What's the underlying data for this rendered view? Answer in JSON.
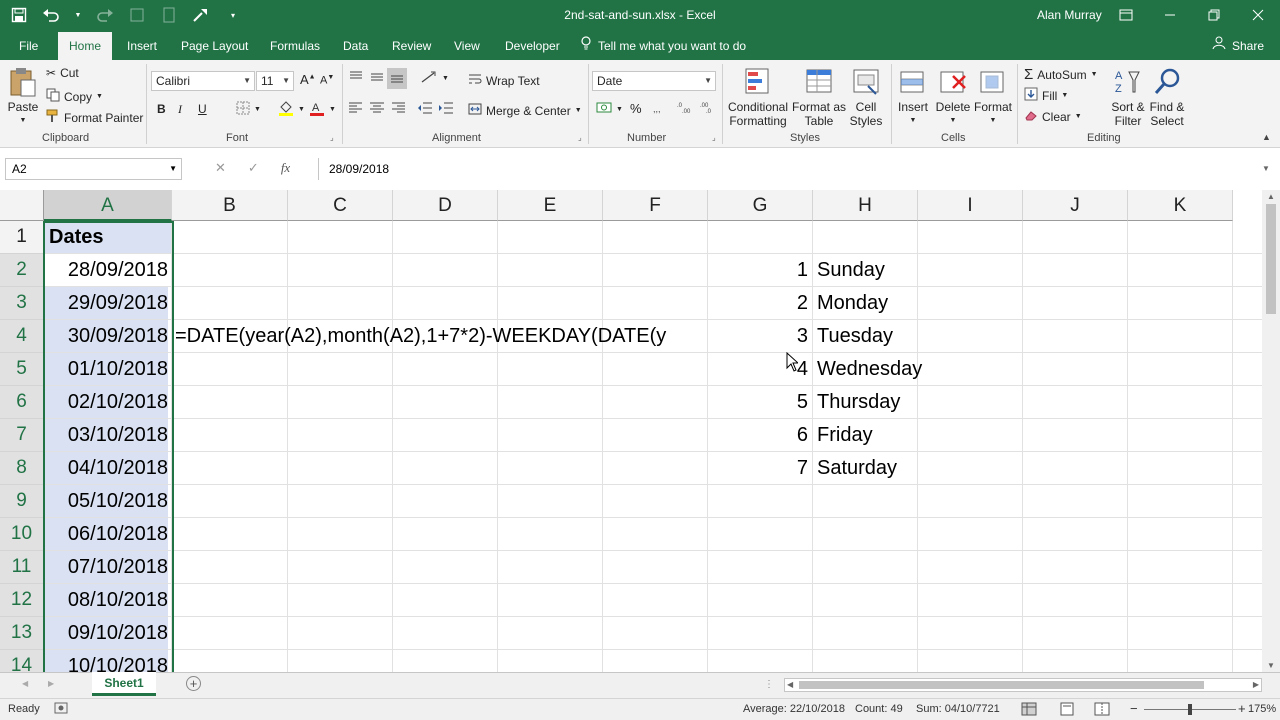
{
  "window": {
    "title": "2nd-sat-and-sun.xlsx  -  Excel",
    "user": "Alan Murray"
  },
  "ribbon_tabs": [
    "File",
    "Home",
    "Insert",
    "Page Layout",
    "Formulas",
    "Data",
    "Review",
    "View",
    "Developer"
  ],
  "tell_me": "Tell me what you want to do",
  "share": "Share",
  "clipboard": {
    "paste": "Paste",
    "cut": "Cut",
    "copy": "Copy",
    "format_painter": "Format Painter",
    "label": "Clipboard"
  },
  "font": {
    "name": "Calibri",
    "size": "11",
    "bold": "B",
    "italic": "I",
    "underline": "U",
    "label": "Font"
  },
  "alignment": {
    "wrap_text": "Wrap Text",
    "merge_center": "Merge & Center",
    "label": "Alignment"
  },
  "number": {
    "format": "Date",
    "percent": "%",
    "label": "Number"
  },
  "styles": {
    "conditional": [
      "Conditional",
      "Formatting"
    ],
    "format_table": [
      "Format as",
      "Table"
    ],
    "cell_styles": [
      "Cell",
      "Styles"
    ],
    "label": "Styles"
  },
  "cells": {
    "insert": "Insert",
    "delete": "Delete",
    "format": "Format",
    "label": "Cells"
  },
  "editing": {
    "autosum": "AutoSum",
    "fill": "Fill",
    "clear": "Clear",
    "sort_filter": [
      "Sort &",
      "Filter"
    ],
    "find_select": [
      "Find &",
      "Select"
    ],
    "label": "Editing"
  },
  "formula_bar": {
    "name_box": "A2",
    "fx": "fx",
    "formula": "28/09/2018"
  },
  "sheet": {
    "columns": [
      "A",
      "B",
      "C",
      "D",
      "E",
      "F",
      "G",
      "H",
      "I",
      "J",
      "K"
    ],
    "rows": [
      "1",
      "2",
      "3",
      "4",
      "5",
      "6",
      "7",
      "8",
      "9",
      "10",
      "11",
      "12",
      "13",
      "14"
    ],
    "header_a1": "Dates",
    "dates": [
      "28/09/2018",
      "29/09/2018",
      "30/09/2018",
      "01/10/2018",
      "02/10/2018",
      "03/10/2018",
      "04/10/2018",
      "05/10/2018",
      "06/10/2018",
      "07/10/2018",
      "08/10/2018",
      "09/10/2018",
      "10/10/2018"
    ],
    "formula_b4": "=DATE(year(A2),month(A2),1+7*2)-WEEKDAY(DATE(y",
    "weekday_numbers": [
      "1",
      "2",
      "3",
      "4",
      "5",
      "6",
      "7"
    ],
    "weekday_names": [
      "Sunday",
      "Monday",
      "Tuesday",
      "Wednesday",
      "Thursday",
      "Friday",
      "Saturday"
    ]
  },
  "sheet_tabs": [
    "Sheet1"
  ],
  "status": {
    "ready": "Ready",
    "average": "Average: 22/10/2018",
    "count": "Count: 49",
    "sum": "Sum: 04/10/7721",
    "zoom": "175%"
  }
}
